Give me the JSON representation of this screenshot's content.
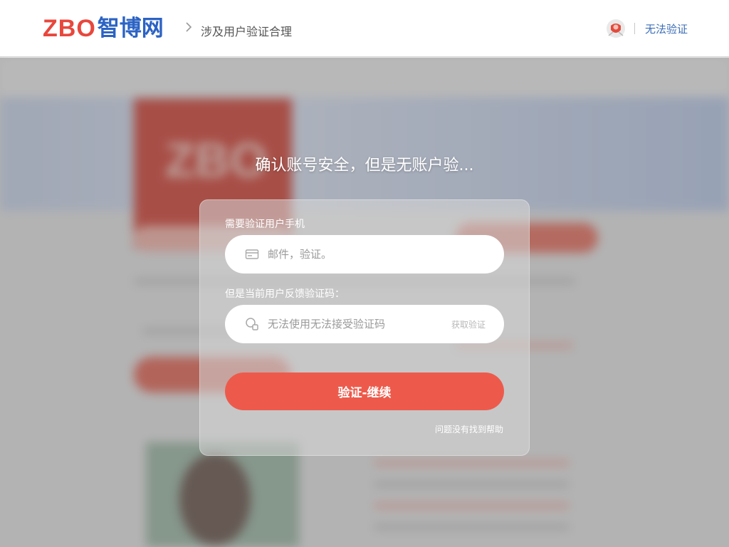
{
  "header": {
    "logo_latin": "ZBO",
    "logo_cn": "智博网",
    "breadcrumb": "涉及用户验证合理",
    "right_link": "无法验证"
  },
  "dialog": {
    "title": "确认账号安全，但是无账户验...",
    "field1_label": "需要验证用户手机",
    "field1_placeholder": "邮件，验证。",
    "field2_label": "但是当前用户反馈验证码：",
    "field2_placeholder": "无法使用无法接受验证码",
    "send_code": "获取验证",
    "submit": "验证-继续",
    "help": "问题没有找到帮助"
  },
  "colors": {
    "brand_red": "#e8473d",
    "brand_blue": "#2c63c4",
    "button": "#ed5a4b"
  },
  "icons": [
    "chevron-right-icon",
    "user-avatar-icon",
    "card-icon",
    "key-icon"
  ]
}
